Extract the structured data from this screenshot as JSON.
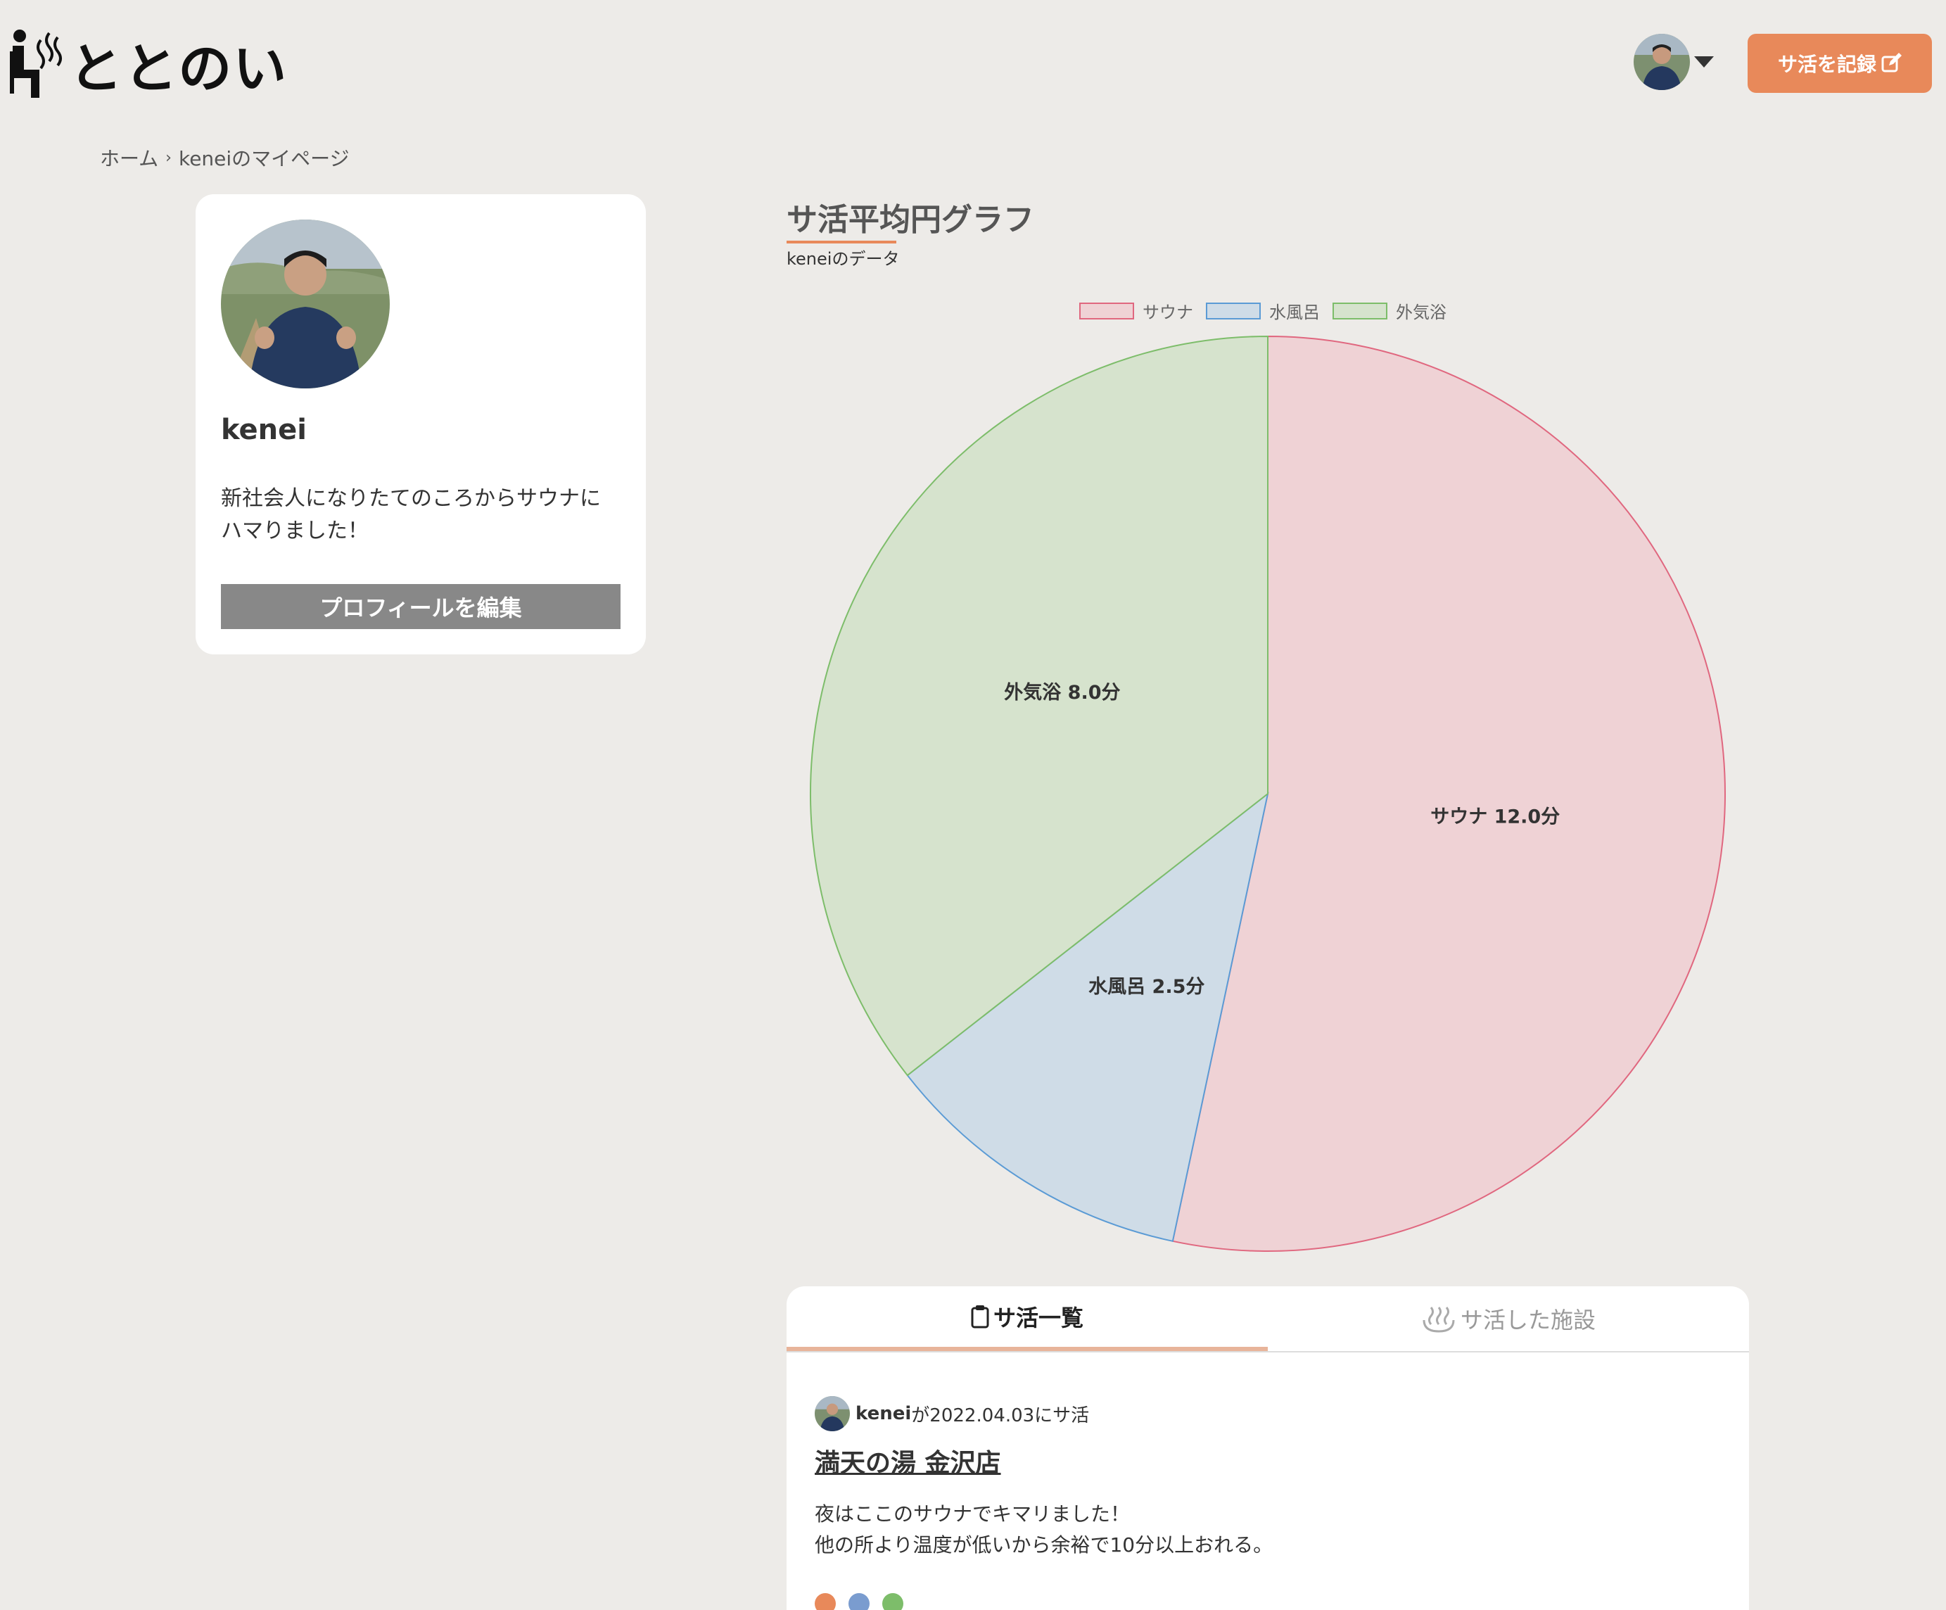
{
  "header": {
    "logo_text": "ととのい",
    "record_button": "サ活を記録"
  },
  "breadcrumb": {
    "home": "ホーム",
    "separator": "›",
    "current": "keneiのマイページ"
  },
  "profile": {
    "name": "kenei",
    "bio_line1": "新社会人になりたてのころからサウナに",
    "bio_line2": "ハマりました！",
    "edit_button": "プロフィールを編集"
  },
  "graph": {
    "title": "サ活平均円グラフ",
    "subtitle": "keneiのデータ"
  },
  "chart_data": {
    "type": "pie",
    "categories": [
      "サウナ",
      "水風呂",
      "外気浴"
    ],
    "values": [
      12.0,
      2.5,
      8.0
    ],
    "slice_labels": [
      "サウナ 12.0分",
      "水風呂 2.5分",
      "外気浴 8.0分"
    ],
    "unit": "分",
    "legend": "top",
    "colors": {
      "fill": [
        "#efd2d5",
        "#cfdce7",
        "#d6e3cd"
      ],
      "stroke": [
        "#e0677f",
        "#5b9bd5",
        "#7dbd6a"
      ]
    }
  },
  "tabs": {
    "active": "サ活一覧",
    "inactive": "サ活した施設"
  },
  "post": {
    "user": "kenei",
    "meta": "が2022.04.03にサ活",
    "title": "満天の湯 金沢店",
    "body_line1": "夜はここのサウナでキマリました！",
    "body_line2": "他の所より温度が低いから余裕で10分以上おれる。"
  },
  "colors": {
    "accent": "#e8895a",
    "background": "#edebe8",
    "edit_button": "#888888"
  },
  "icons": {
    "logo": "sauna-person-icon",
    "record": "edit-icon",
    "tab_list": "clipboard-icon",
    "tab_facility": "hot-spring-icon"
  }
}
